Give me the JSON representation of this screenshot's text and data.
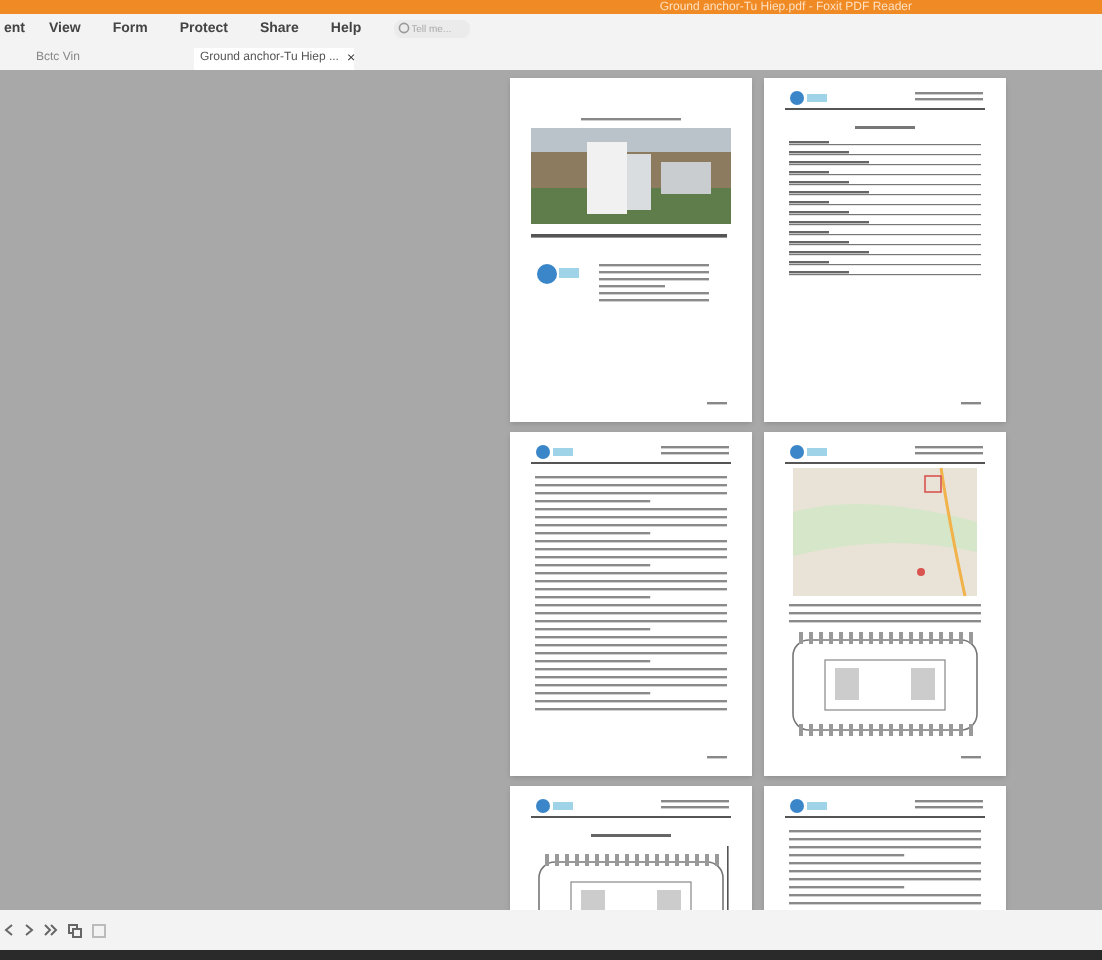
{
  "window": {
    "title": "Ground anchor-Tu Hiep.pdf - Foxit PDF Reader"
  },
  "menu": [
    {
      "label": "ent"
    },
    {
      "label": "View"
    },
    {
      "label": "Form"
    },
    {
      "label": "Protect"
    },
    {
      "label": "Share"
    },
    {
      "label": "Help"
    }
  ],
  "search": {
    "placeholder": "Tell me..."
  },
  "tabs": [
    {
      "label": "Bctc Vin",
      "selected": false
    },
    {
      "label": "Ground anchor-Tu Hiep ...",
      "selected": true,
      "close": "×"
    }
  ],
  "pages": [
    {
      "kind": "cover"
    },
    {
      "kind": "toc"
    },
    {
      "kind": "text"
    },
    {
      "kind": "map"
    },
    {
      "kind": "plan"
    },
    {
      "kind": "text"
    }
  ]
}
